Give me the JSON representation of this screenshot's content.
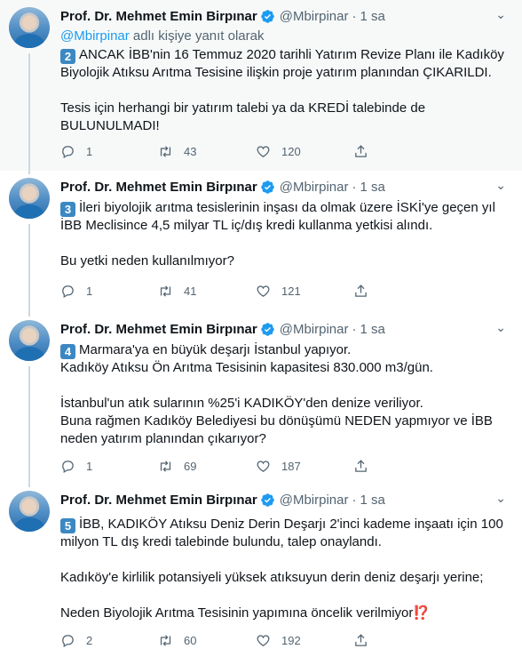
{
  "author": {
    "name": "Prof. Dr. Mehmet Emin Birpınar",
    "handle": "@Mbirpinar",
    "separator": "·",
    "time": "1 sa"
  },
  "tweets": [
    {
      "reply_prefix": "@Mbirpinar",
      "reply_suffix": " adlı kişiye yanıt olarak",
      "number": "2",
      "lines": [
        "ANCAK İBB'nin 16 Temmuz 2020 tarihli Yatırım Revize Planı ile Kadıköy",
        "Biyolojik Atıksu Arıtma Tesisine ilişkin proje yatırım planından ÇIKARILDI.",
        "",
        "Tesis için herhangi bir yatırım talebi ya da KREDİ talebinde de",
        "BULUNULMADI!"
      ],
      "replies": "1",
      "retweets": "43",
      "likes": "120"
    },
    {
      "number": "3",
      "lines": [
        "İleri biyolojik arıtma tesislerinin inşası da olmak üzere İSKİ'ye geçen yıl",
        "İBB Meclisince 4,5 milyar TL iç/dış kredi kullanma yetkisi alındı.",
        "",
        "Bu yetki neden kullanılmıyor?"
      ],
      "replies": "1",
      "retweets": "41",
      "likes": "121"
    },
    {
      "number": "4",
      "lines": [
        "Marmara'ya en büyük deşarjı İstanbul yapıyor.",
        "Kadıköy Atıksu Ön Arıtma Tesisinin kapasitesi 830.000 m3/gün.",
        "",
        "İstanbul'un atık sularının %25'i KADIKÖY'den denize veriliyor.",
        "Buna rağmen Kadıköy Belediyesi bu dönüşümü NEDEN yapmıyor ve İBB",
        "neden yatırım planından çıkarıyor?"
      ],
      "replies": "1",
      "retweets": "69",
      "likes": "187"
    },
    {
      "number": "5",
      "lines": [
        "İBB,  KADIKÖY Atıksu Deniz Derin Deşarjı 2'inci kademe inşaatı için 100",
        "milyon TL dış kredi talebinde bulundu, talep onaylandı.",
        "",
        "Kadıköy'e kirlilik potansiyeli yüksek atıksuyun derin deniz deşarjı yerine;",
        "",
        "Neden Biyolojik Arıtma Tesisinin yapımına öncelik verilmiyor"
      ],
      "emoji": "⁉️",
      "replies": "2",
      "retweets": "60",
      "likes": "192"
    }
  ]
}
